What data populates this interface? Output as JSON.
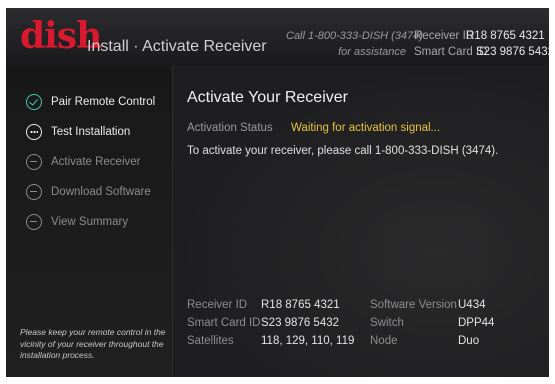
{
  "header": {
    "logo_text": "dish",
    "title": "Install · Activate Receiver",
    "call_text": "Call 1-800-333-DISH (3474)",
    "assist_text": "for assistance",
    "receiver_id_label": "Receiver ID",
    "receiver_id_value": "R18 8765 4321",
    "smart_card_label": "Smart Card ID",
    "smart_card_value": "S23 9876 5432"
  },
  "sidebar": {
    "steps": [
      {
        "label": "Pair Remote Control",
        "state": "done",
        "icon": "check-circle-icon"
      },
      {
        "label": "Test Installation",
        "state": "current",
        "icon": "ellipsis-circle-icon"
      },
      {
        "label": "Activate Receiver",
        "state": "pending",
        "icon": "minus-circle-icon"
      },
      {
        "label": "Download Software",
        "state": "pending",
        "icon": "minus-circle-icon"
      },
      {
        "label": "View Summary",
        "state": "pending",
        "icon": "minus-circle-icon"
      }
    ],
    "note": "Please keep your remote control in the vicinity of your receiver throughout the installation process."
  },
  "main": {
    "title": "Activate Your Receiver",
    "status_label": "Activation Status",
    "status_value": "Waiting for activation signal...",
    "instructions": "To activate your receiver, please call 1-800-333-DISH (3474).",
    "info": {
      "receiver_id_label": "Receiver ID",
      "receiver_id_value": "R18 8765 4321",
      "smart_card_label": "Smart Card ID",
      "smart_card_value": "S23 9876 5432",
      "satellites_label": "Satellites",
      "satellites_value": "118, 129, 110, 119",
      "software_label": "Software Version",
      "software_value": "U434",
      "switch_label": "Switch",
      "switch_value": "DPP44",
      "node_label": "Node",
      "node_value": "Duo"
    }
  },
  "colors": {
    "brand_red": "#d8192e",
    "done_teal": "#46c7b4",
    "status_yellow": "#e6c341",
    "background": "#1d1d1f"
  }
}
